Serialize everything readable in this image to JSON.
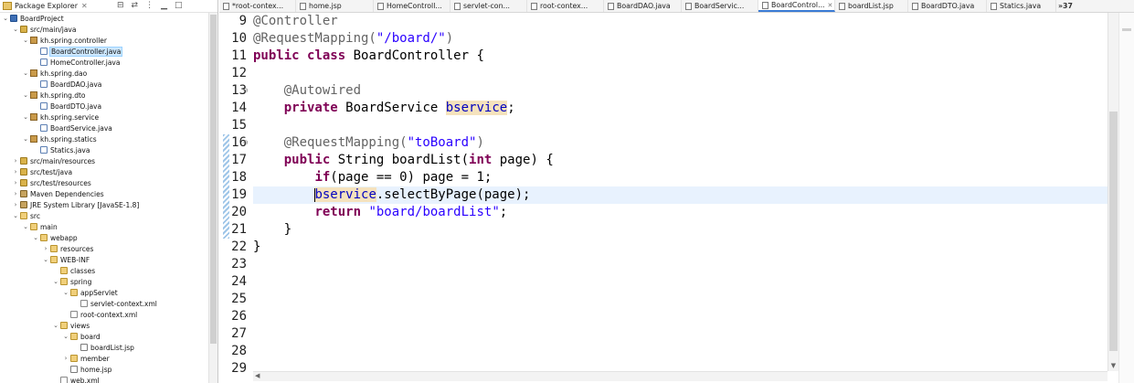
{
  "package_explorer": {
    "title": "Package Explorer",
    "tree": [
      {
        "label": "BoardProject",
        "type": "project",
        "expanded": true,
        "depth": 0
      },
      {
        "label": "src/main/java",
        "type": "srcfolder",
        "expanded": true,
        "depth": 1
      },
      {
        "label": "kh.spring.controller",
        "type": "pkg",
        "expanded": true,
        "depth": 2
      },
      {
        "label": "BoardController.java",
        "type": "java",
        "expanded": false,
        "depth": 3,
        "selected": true
      },
      {
        "label": "HomeController.java",
        "type": "java",
        "expanded": false,
        "depth": 3
      },
      {
        "label": "kh.spring.dao",
        "type": "pkg",
        "expanded": true,
        "depth": 2
      },
      {
        "label": "BoardDAO.java",
        "type": "java",
        "expanded": false,
        "depth": 3
      },
      {
        "label": "kh.spring.dto",
        "type": "pkg",
        "expanded": true,
        "depth": 2
      },
      {
        "label": "BoardDTO.java",
        "type": "java",
        "expanded": false,
        "depth": 3
      },
      {
        "label": "kh.spring.service",
        "type": "pkg",
        "expanded": true,
        "depth": 2
      },
      {
        "label": "BoardService.java",
        "type": "java",
        "expanded": false,
        "depth": 3
      },
      {
        "label": "kh.spring.statics",
        "type": "pkg",
        "expanded": true,
        "depth": 2
      },
      {
        "label": "Statics.java",
        "type": "java",
        "expanded": false,
        "depth": 3
      },
      {
        "label": "src/main/resources",
        "type": "srcfolder",
        "expanded": false,
        "depth": 1
      },
      {
        "label": "src/test/java",
        "type": "srcfolder",
        "expanded": false,
        "depth": 1
      },
      {
        "label": "src/test/resources",
        "type": "srcfolder",
        "expanded": false,
        "depth": 1
      },
      {
        "label": "Maven Dependencies",
        "type": "lib",
        "expanded": false,
        "depth": 1
      },
      {
        "label": "JRE System Library [JavaSE-1.8]",
        "type": "lib",
        "expanded": false,
        "depth": 1
      },
      {
        "label": "src",
        "type": "folder",
        "expanded": true,
        "depth": 1
      },
      {
        "label": "main",
        "type": "folder",
        "expanded": true,
        "depth": 2
      },
      {
        "label": "webapp",
        "type": "folder",
        "expanded": true,
        "depth": 3
      },
      {
        "label": "resources",
        "type": "folder",
        "expanded": false,
        "depth": 4
      },
      {
        "label": "WEB-INF",
        "type": "folder",
        "expanded": true,
        "depth": 4
      },
      {
        "label": "classes",
        "type": "folder",
        "expanded": false,
        "depth": 5
      },
      {
        "label": "spring",
        "type": "folder",
        "expanded": true,
        "depth": 5
      },
      {
        "label": "appServlet",
        "type": "folder",
        "expanded": true,
        "depth": 6
      },
      {
        "label": "servlet-context.xml",
        "type": "xml",
        "expanded": false,
        "depth": 7
      },
      {
        "label": "root-context.xml",
        "type": "xml",
        "expanded": false,
        "depth": 6
      },
      {
        "label": "views",
        "type": "folder",
        "expanded": true,
        "depth": 5
      },
      {
        "label": "board",
        "type": "folder",
        "expanded": true,
        "depth": 6
      },
      {
        "label": "boardList.jsp",
        "type": "jsp",
        "expanded": false,
        "depth": 7
      },
      {
        "label": "member",
        "type": "folder",
        "expanded": false,
        "depth": 6
      },
      {
        "label": "home.jsp",
        "type": "jsp",
        "expanded": false,
        "depth": 6
      },
      {
        "label": "web.xml",
        "type": "xml",
        "expanded": false,
        "depth": 5
      }
    ]
  },
  "editor_tabs": [
    {
      "label": "*root-contex...",
      "active": false
    },
    {
      "label": "home.jsp",
      "active": false
    },
    {
      "label": "HomeControll...",
      "active": false
    },
    {
      "label": "servlet-con...",
      "active": false
    },
    {
      "label": "root-contex...",
      "active": false
    },
    {
      "label": "BoardDAO.java",
      "active": false
    },
    {
      "label": "BoardServic...",
      "active": false
    },
    {
      "label": "BoardControl...",
      "active": true
    },
    {
      "label": "boardList.jsp",
      "active": false
    },
    {
      "label": "BoardDTO.java",
      "active": false
    },
    {
      "label": "Statics.java",
      "active": false
    }
  ],
  "tab_overflow": "»37",
  "editor": {
    "lines": [
      {
        "num": "9",
        "segs": [
          {
            "t": "@Controller",
            "c": "ann"
          }
        ]
      },
      {
        "num": "10",
        "segs": [
          {
            "t": "@RequestMapping(",
            "c": "ann"
          },
          {
            "t": "\"/board/\"",
            "c": "str"
          },
          {
            "t": ")",
            "c": "ann"
          }
        ]
      },
      {
        "num": "11",
        "segs": [
          {
            "t": "public",
            "c": "kw"
          },
          {
            "t": " ",
            "c": ""
          },
          {
            "t": "class",
            "c": "kw"
          },
          {
            "t": " BoardController {",
            "c": ""
          }
        ]
      },
      {
        "num": "12",
        "segs": []
      },
      {
        "num": "13",
        "segs": [
          {
            "t": "    ",
            "c": ""
          },
          {
            "t": "@Autowired",
            "c": "ann"
          }
        ],
        "fold": "⊖"
      },
      {
        "num": "14",
        "segs": [
          {
            "t": "    ",
            "c": ""
          },
          {
            "t": "private",
            "c": "kw"
          },
          {
            "t": " BoardService ",
            "c": ""
          },
          {
            "t": "bservice",
            "c": "fld occ"
          },
          {
            "t": ";",
            "c": ""
          }
        ]
      },
      {
        "num": "15",
        "segs": []
      },
      {
        "num": "16",
        "segs": [
          {
            "t": "    ",
            "c": ""
          },
          {
            "t": "@RequestMapping(",
            "c": "ann"
          },
          {
            "t": "\"toBoard\"",
            "c": "str"
          },
          {
            "t": ")",
            "c": "ann"
          }
        ],
        "fold": "⊖"
      },
      {
        "num": "17",
        "segs": [
          {
            "t": "    ",
            "c": ""
          },
          {
            "t": "public",
            "c": "kw"
          },
          {
            "t": " String boardList(",
            "c": ""
          },
          {
            "t": "int",
            "c": "kw"
          },
          {
            "t": " page) {",
            "c": ""
          }
        ]
      },
      {
        "num": "18",
        "segs": [
          {
            "t": "        ",
            "c": ""
          },
          {
            "t": "if",
            "c": "kw"
          },
          {
            "t": "(page == 0) page = 1;",
            "c": ""
          }
        ]
      },
      {
        "num": "19",
        "segs": [
          {
            "t": "        ",
            "c": ""
          },
          {
            "t": "bservice",
            "c": "fld occ"
          },
          {
            "t": ".selectByPage(page);",
            "c": ""
          }
        ],
        "current": true
      },
      {
        "num": "20",
        "segs": [
          {
            "t": "        ",
            "c": ""
          },
          {
            "t": "return",
            "c": "kw"
          },
          {
            "t": " ",
            "c": ""
          },
          {
            "t": "\"board/boardList\"",
            "c": "str"
          },
          {
            "t": ";",
            "c": ""
          }
        ]
      },
      {
        "num": "21",
        "segs": [
          {
            "t": "    }",
            "c": ""
          }
        ]
      },
      {
        "num": "22",
        "segs": [
          {
            "t": "}",
            "c": ""
          }
        ]
      },
      {
        "num": "23",
        "segs": []
      },
      {
        "num": "24",
        "segs": []
      },
      {
        "num": "25",
        "segs": []
      },
      {
        "num": "26",
        "segs": []
      },
      {
        "num": "27",
        "segs": []
      },
      {
        "num": "28",
        "segs": []
      },
      {
        "num": "29",
        "segs": []
      }
    ]
  },
  "colors": {
    "keyword": "#7f0055",
    "annotation": "#646464",
    "string": "#2a00ff",
    "field": "#0000c0",
    "occurrence_highlight": "#f5e2bd",
    "current_line": "#e8f2fe",
    "selection_blue": "#cde8ff"
  }
}
